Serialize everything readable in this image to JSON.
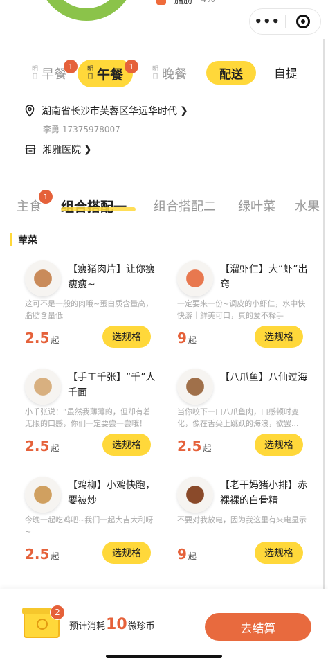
{
  "top": {
    "fat_label": "脂肪",
    "fat_value": "4%"
  },
  "capsule": {
    "more": "•••"
  },
  "meals": {
    "tabs": [
      {
        "small": "明日",
        "label": "早餐",
        "badge": "1"
      },
      {
        "small": "明日",
        "label": "午餐",
        "badge": "1"
      },
      {
        "small": "明日",
        "label": "晚餐",
        "badge": ""
      }
    ],
    "deliver": "配送",
    "pickup": "自提"
  },
  "address": {
    "line": "湖南省长沙市芙蓉区华远华时代",
    "contact": "李勇 17375978007",
    "hospital": "湘雅医院"
  },
  "categories": {
    "items": [
      "主食",
      "组合搭配一",
      "组合搭配二",
      "绿叶菜",
      "水果"
    ],
    "main_badge": "1"
  },
  "section": {
    "title": "荤菜"
  },
  "dishes": [
    {
      "name": "【瘦猪肉片】让你瘦瘦瘦~",
      "desc": "这可不是一般的肉哦~蛋白质含量高，脂肪含量低",
      "price": "2.5",
      "unit": "起",
      "button": "选规格"
    },
    {
      "name": "【溜虾仁】大“虾”出窍",
      "desc": "一定要来一份~调皮的小虾仁，水中快快游｜鲜美可口，真的爱不释手",
      "price": "9",
      "unit": "起",
      "button": "选规格"
    },
    {
      "name": "【手工千张】“千”人千面",
      "desc": "小千张说：“虽然我薄薄的，但却有着无限的口感，你们一定要尝一尝哦！",
      "price": "2.5",
      "unit": "起",
      "button": "选规格"
    },
    {
      "name": "【八爪鱼】八仙过海",
      "desc": "当你咬下一口八爪鱼肉，口感顿时变化，像在舌尖上跳跃的海浪，欲罢...",
      "price": "2.5",
      "unit": "起",
      "button": "选规格"
    },
    {
      "name": "【鸡柳】小鸡快跑，要被炒",
      "desc": "今晚一起吃鸡吧~我们一起大吉大利呀~",
      "price": "2.5",
      "unit": "起",
      "button": "选规格"
    },
    {
      "name": "【老干妈猪小排】赤裸裸的白骨精",
      "desc": "不要对我放电，因为我这里有来电显示",
      "price": "9",
      "unit": "起",
      "button": "选规格"
    }
  ],
  "bottom": {
    "badge": "2",
    "est_prefix": "预计消耗",
    "est_num": "10",
    "est_suffix": "微珍币",
    "checkout": "去结算"
  },
  "colors": {
    "accent": "#ffd83a",
    "orange": "#e5613a",
    "checkout": "#e86a3e"
  }
}
